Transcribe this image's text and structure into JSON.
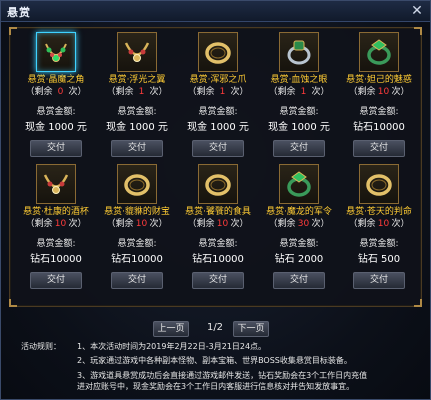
{
  "window": {
    "title": "悬赏",
    "close_icon": "close-x-icon"
  },
  "labels": {
    "amount_label": "悬赏金额:",
    "remain_prefix": "（剩余",
    "remain_suffix": "次）",
    "submit": "交付"
  },
  "items": [
    {
      "name": "悬赏·晶魔之角",
      "remain": "0",
      "amount": "现金 1000 元",
      "icon": "green-gem-necklace-icon",
      "selected": true
    },
    {
      "name": "悬赏·浮光之翼",
      "remain": "1",
      "amount": "现金 1000 元",
      "icon": "gem-necklace-icon",
      "selected": false
    },
    {
      "name": "悬赏·浑邪之爪",
      "remain": "1",
      "amount": "现金 1000 元",
      "icon": "gold-bracelet-icon",
      "selected": false
    },
    {
      "name": "悬赏·血蚀之眼",
      "remain": "1",
      "amount": "现金 1000 元",
      "icon": "gem-ring-icon",
      "selected": false
    },
    {
      "name": "悬赏·妲己的魅惑",
      "remain": "10",
      "amount": "钻石10000",
      "icon": "jade-ring-icon",
      "selected": false
    },
    {
      "name": "悬赏·杜康的酒杯",
      "remain": "10",
      "amount": "钻石10000",
      "icon": "gem-necklace-icon",
      "selected": false
    },
    {
      "name": "悬赏·貔貅的财宝",
      "remain": "10",
      "amount": "钻石10000",
      "icon": "gold-bracelet-icon",
      "selected": false
    },
    {
      "name": "悬赏·饕餮的食具",
      "remain": "10",
      "amount": "钻石10000",
      "icon": "gold-bracelet-icon",
      "selected": false
    },
    {
      "name": "悬赏·魔龙的军令",
      "remain": "30",
      "amount": "钻石 2000",
      "icon": "jade-ring-icon",
      "selected": false
    },
    {
      "name": "悬赏·苍天的判命",
      "remain": "10",
      "amount": "钻石 500",
      "icon": "gold-bracelet-icon",
      "selected": false
    }
  ],
  "pager": {
    "prev": "上一页",
    "page": "1/2",
    "next": "下一页"
  },
  "rules": {
    "head": "活动规则：",
    "lines": [
      "1、本次活动时间为2019年2月22日-3月21日24点。",
      "2、玩家通过游戏中各种副本怪物、副本宝箱、世界BOSS收集悬赏目标装备。",
      "3、游戏道具悬赏成功后会直接通过游戏邮件发送，钻石奖励会在3个工作日内充值",
      "进对应账号中，现金奖励会在3个工作日内客服进行信息核对并告知发放事宜。"
    ]
  },
  "colors": {
    "item_name": "#ffcc33",
    "remain_count": "#ff3b3b",
    "frame_gold": "#8a6a34",
    "selected_glow": "#3fd2ff"
  }
}
